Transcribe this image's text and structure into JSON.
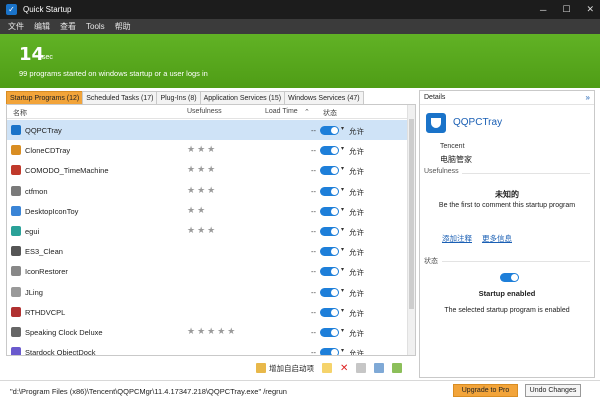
{
  "window": {
    "title": "Quick Startup"
  },
  "menu": [
    "文件",
    "编辑",
    "查看",
    "Tools",
    "帮助"
  ],
  "banner": {
    "seconds": "14",
    "unit": "sec",
    "subtitle": "99 programs started on windows startup or a user logs in"
  },
  "tabs": [
    "Startup Programs (12)",
    "Scheduled Tasks (17)",
    "Plug-Ins (8)",
    "Application Services (15)",
    "Windows Services (47)"
  ],
  "columns": {
    "name": "名称",
    "usefulness": "Usefulness",
    "load_time": "Load Time",
    "status": "状态"
  },
  "rows": [
    {
      "name": "QQPCTray",
      "stars": 0,
      "load": "--",
      "status": "允许",
      "enabled": true,
      "icon_color": "#1a73c9"
    },
    {
      "name": "CloneCDTray",
      "stars": 3,
      "load": "--",
      "status": "允许",
      "enabled": true,
      "icon_color": "#d98d22"
    },
    {
      "name": "COMODO_TimeMachine",
      "stars": 3,
      "load": "--",
      "status": "允许",
      "enabled": true,
      "icon_color": "#c0392b"
    },
    {
      "name": "ctfmon",
      "stars": 3,
      "load": "--",
      "status": "允许",
      "enabled": true,
      "icon_color": "#7a7a7a"
    },
    {
      "name": "DesktopIconToy",
      "stars": 2,
      "load": "--",
      "status": "允许",
      "enabled": true,
      "icon_color": "#3a84d6"
    },
    {
      "name": "egui",
      "stars": 3,
      "load": "--",
      "status": "允许",
      "enabled": true,
      "icon_color": "#2aa198"
    },
    {
      "name": "ES3_Clean",
      "stars": 0,
      "load": "--",
      "status": "允许",
      "enabled": true,
      "icon_color": "#555555"
    },
    {
      "name": "IconRestorer",
      "stars": 0,
      "load": "--",
      "status": "允许",
      "enabled": true,
      "icon_color": "#888888"
    },
    {
      "name": "JLing",
      "stars": 0,
      "load": "--",
      "status": "允许",
      "enabled": true,
      "icon_color": "#999999"
    },
    {
      "name": "RTHDVCPL",
      "stars": 0,
      "load": "--",
      "status": "允许",
      "enabled": true,
      "icon_color": "#b03030"
    },
    {
      "name": "Speaking Clock Deluxe",
      "stars": 5,
      "load": "--",
      "status": "允许",
      "enabled": true,
      "icon_color": "#666666"
    },
    {
      "name": "Stardock ObjectDock",
      "stars": 0,
      "load": "--",
      "status": "允许",
      "enabled": true,
      "icon_color": "#6a5acd"
    }
  ],
  "toolbar": {
    "add_label": "增加自启动项"
  },
  "details": {
    "header": "Details",
    "app_name": "QQPCTray",
    "vendor_en": "Tencent",
    "vendor_cn": "电脑管家",
    "usefulness_label": "Usefulness",
    "unknown": "未知的",
    "first_comment": "Be the first to comment this startup program",
    "add_comment": "添加注释",
    "more_info": "更多信息",
    "status_label": "状态",
    "enabled_text": "Startup enabled",
    "enabled_desc": "The selected startup program is enabled"
  },
  "status": {
    "command": "\"d:\\Program Files (x86)\\Tencent\\QQPCMgr\\11.4.17347.218\\QQPCTray.exe\" /regrun",
    "upgrade": "Upgrade to Pro",
    "undo": "Undo Changes"
  },
  "colors": {
    "accent": "#f2a43a",
    "banner": "#57a81c",
    "toggle": "#1e7fd9",
    "link": "#1a5fb4"
  }
}
